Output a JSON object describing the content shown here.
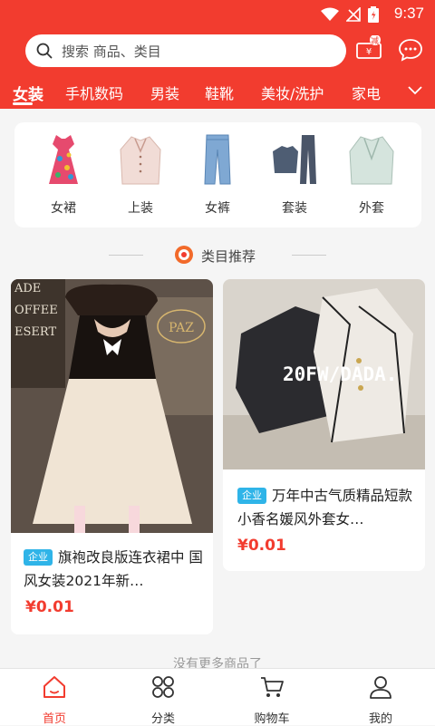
{
  "status": {
    "time": "9:37"
  },
  "header": {
    "search_placeholder": "搜索 商品、类目",
    "coupon_badge": "减"
  },
  "tabs": [
    "女装",
    "手机数码",
    "男装",
    "鞋靴",
    "美妆/洗护",
    "家电"
  ],
  "categories": [
    {
      "label": "女裙",
      "icon": "dress-icon"
    },
    {
      "label": "上装",
      "icon": "blouse-icon"
    },
    {
      "label": "女裤",
      "icon": "jeans-icon"
    },
    {
      "label": "套装",
      "icon": "suit-set-icon"
    },
    {
      "label": "外套",
      "icon": "coat-icon"
    }
  ],
  "section": {
    "title": "类目推荐"
  },
  "products": [
    {
      "badge": "企业",
      "title": "旗袍改良版连衣裙中 国风女装2021年新…",
      "price": "¥0.01",
      "image_text": "PAZ"
    },
    {
      "badge": "企业",
      "title": "万年中古气质精品短款小香名媛风外套女…",
      "price": "¥0.01",
      "image_text": "20FW/DADA."
    }
  ],
  "footer": {
    "no_more": "没有更多商品了"
  },
  "bottom_nav": [
    {
      "label": "首页",
      "icon": "home-icon",
      "active": true
    },
    {
      "label": "分类",
      "icon": "category-icon",
      "active": false
    },
    {
      "label": "购物车",
      "icon": "cart-icon",
      "active": false
    },
    {
      "label": "我的",
      "icon": "user-icon",
      "active": false
    }
  ],
  "colors": {
    "brand": "#f23c2f",
    "badge": "#2fb4e8"
  }
}
